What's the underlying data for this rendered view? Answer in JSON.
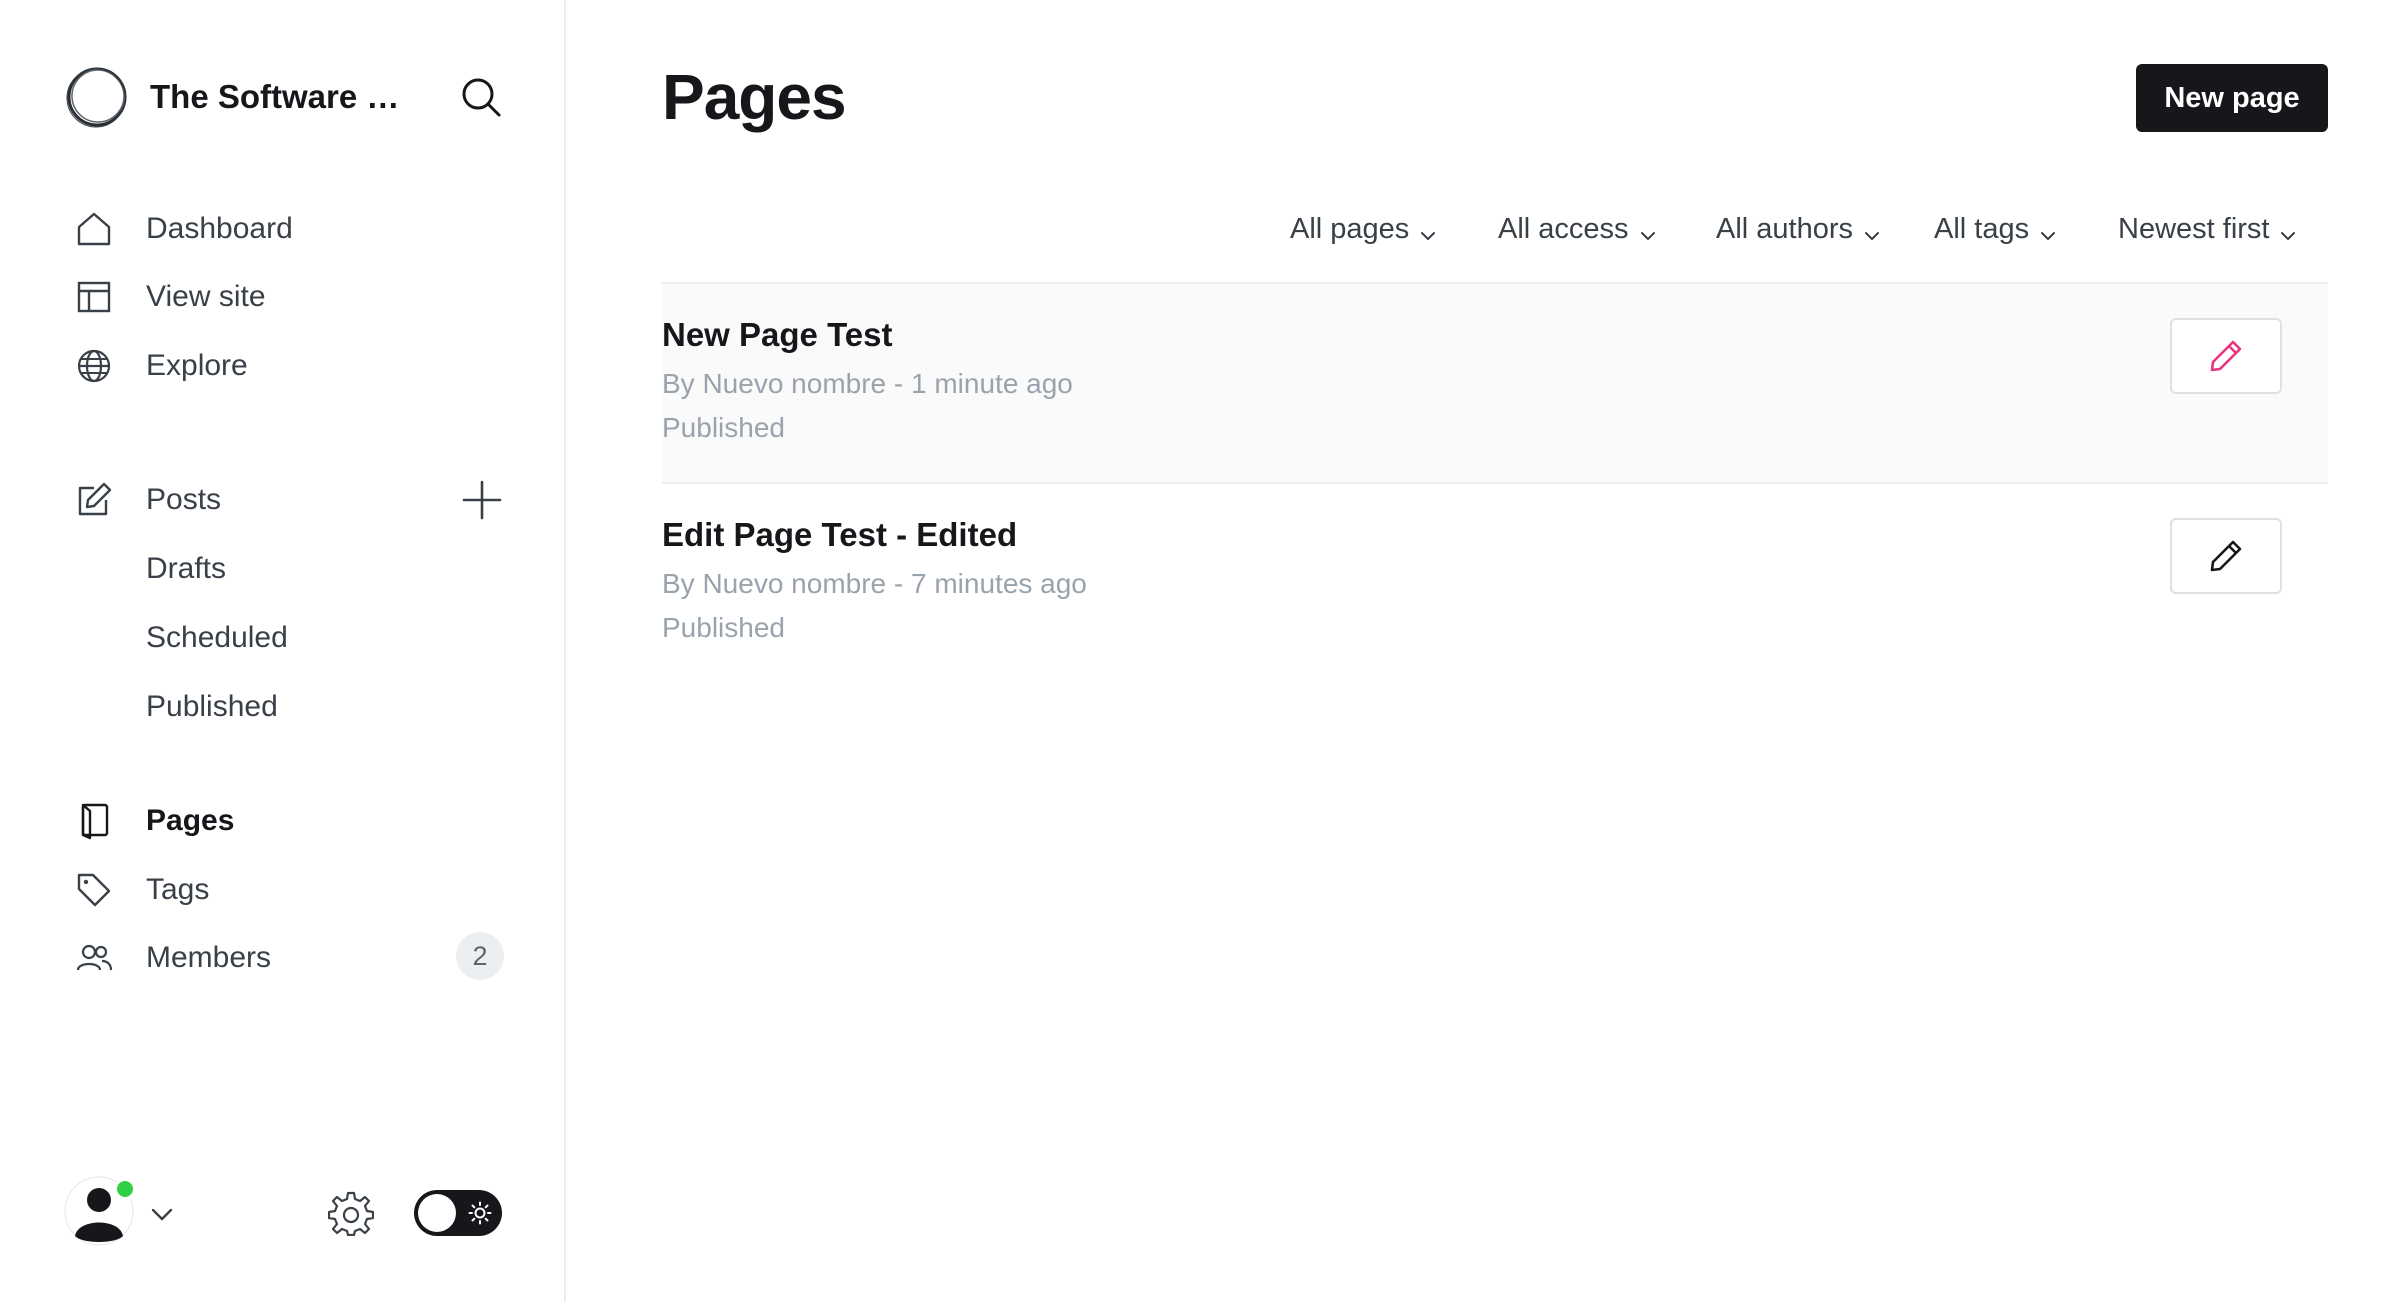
{
  "sidebar": {
    "site_title": "The Software De...",
    "nav": [
      {
        "label": "Dashboard",
        "icon": "home-icon"
      },
      {
        "label": "View site",
        "icon": "layout-icon"
      },
      {
        "label": "Explore",
        "icon": "globe-icon"
      }
    ],
    "posts": {
      "label": "Posts",
      "icon": "edit-icon",
      "sub_items": [
        "Drafts",
        "Scheduled",
        "Published"
      ]
    },
    "secondary": [
      {
        "label": "Pages",
        "icon": "page-icon",
        "active": true
      },
      {
        "label": "Tags",
        "icon": "tag-icon"
      },
      {
        "label": "Members",
        "icon": "members-icon",
        "count": "2"
      }
    ],
    "footer": {
      "online_status_color": "#30cf43",
      "theme_mode": "light"
    }
  },
  "main": {
    "title": "Pages",
    "new_button_label": "New page",
    "filters": [
      "All pages",
      "All access",
      "All authors",
      "All tags",
      "Newest first"
    ],
    "pages": [
      {
        "title": "New Page Test",
        "meta": "By Nuevo nombre - 1 minute ago",
        "status": "Published",
        "hovered": true
      },
      {
        "title": "Edit Page Test - Edited",
        "meta": "By Nuevo nombre - 7 minutes ago",
        "status": "Published",
        "hovered": false
      }
    ]
  },
  "colors": {
    "accent_pink": "#e9357f",
    "text_primary": "#15171a",
    "text_muted": "#99a3ad",
    "button_dark": "#15171a",
    "online_green": "#30cf43"
  }
}
